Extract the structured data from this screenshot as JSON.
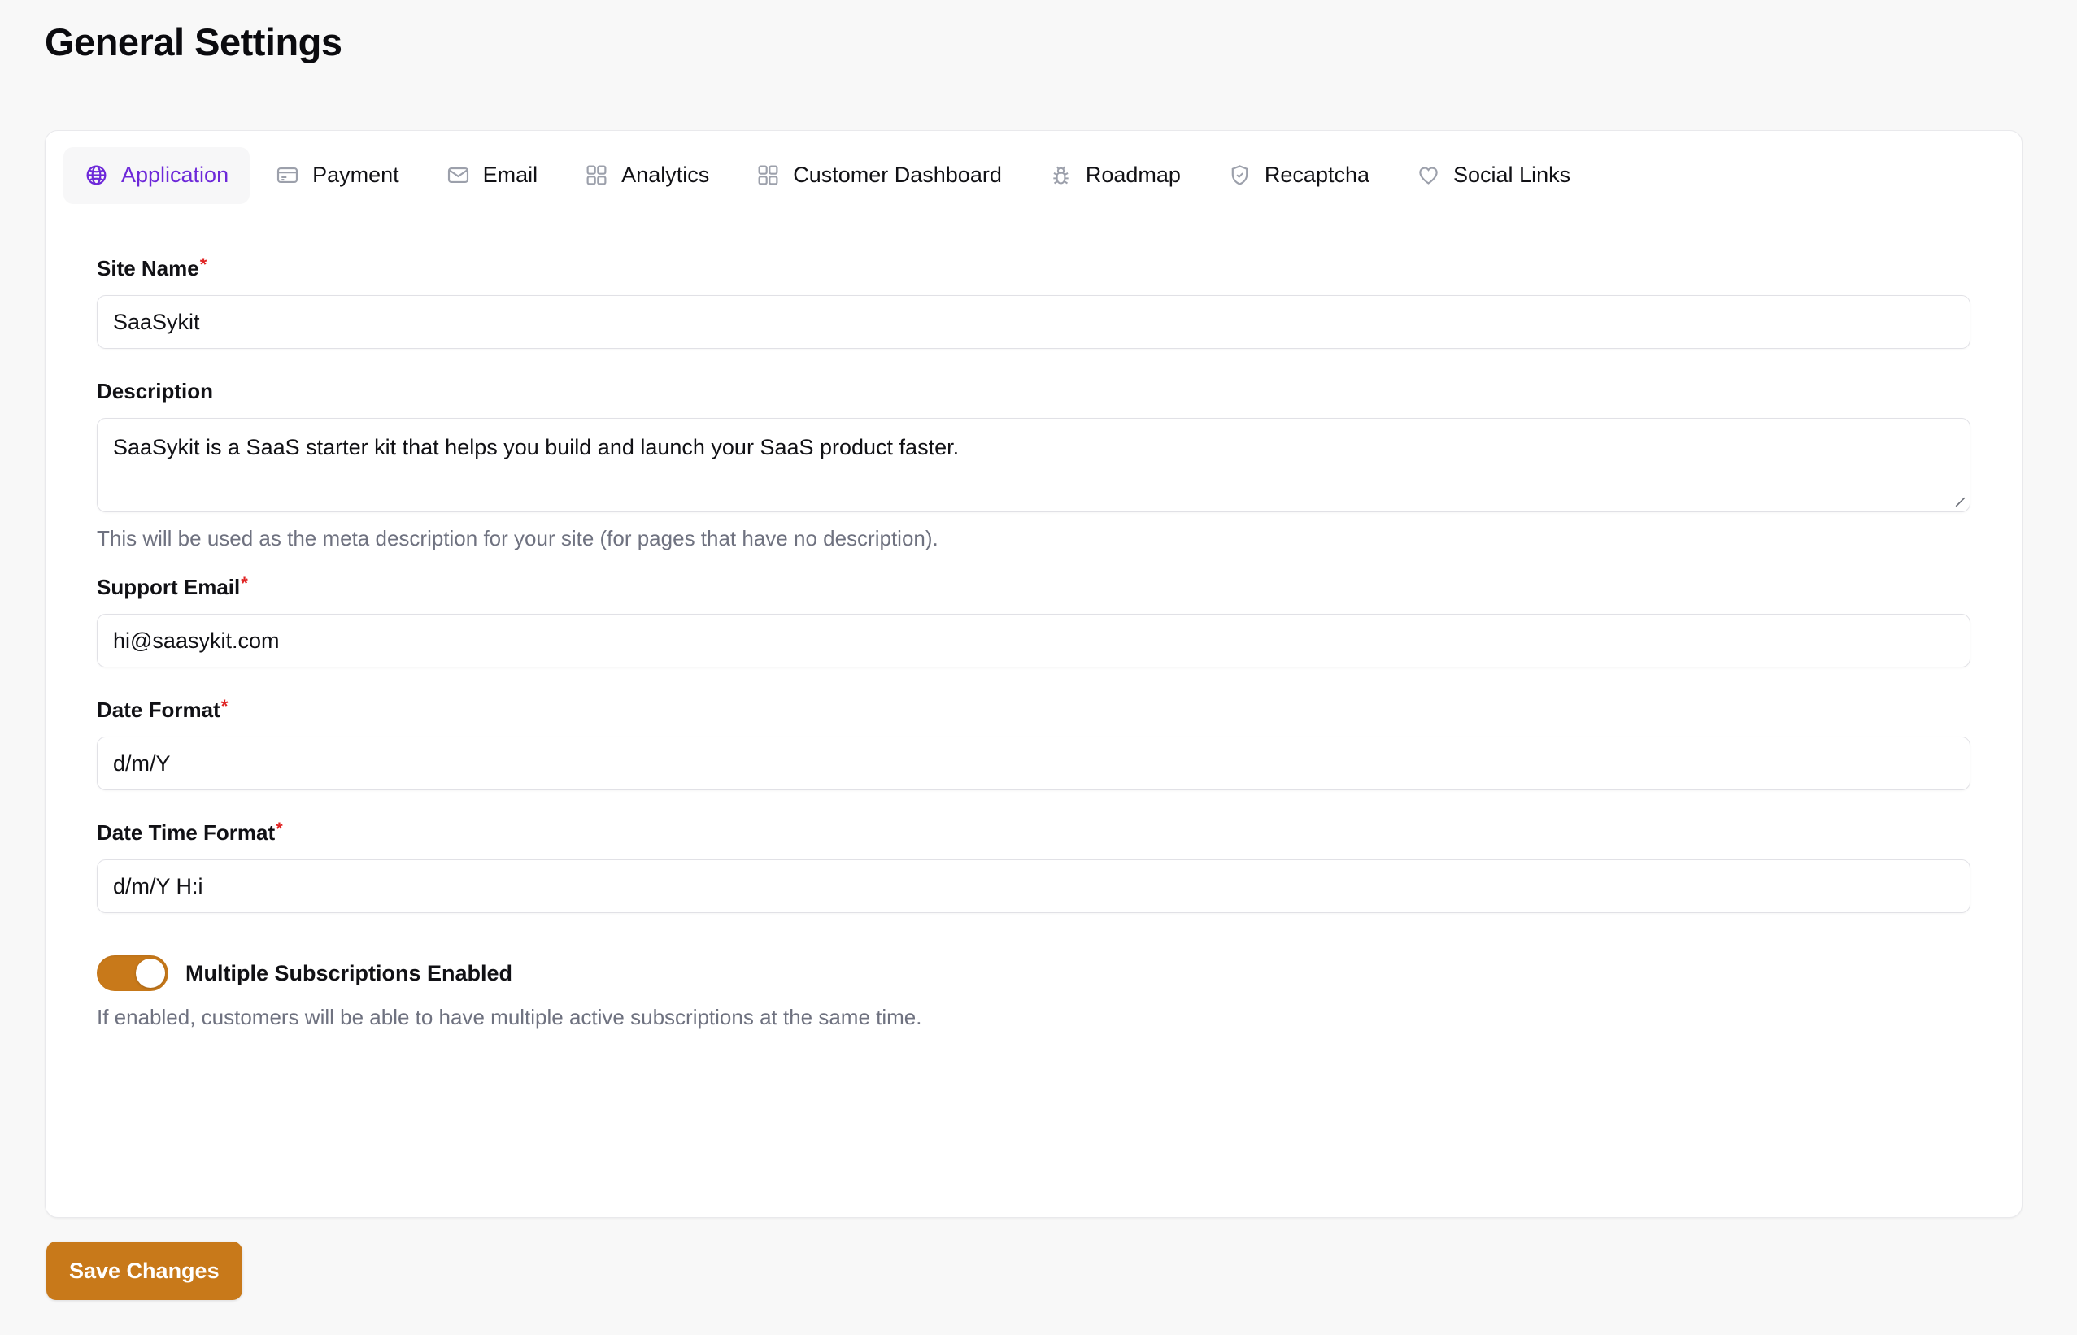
{
  "page": {
    "title": "General Settings",
    "accent_purple": "#6d28d9",
    "accent_amber": "#c8791a",
    "required_marker": "*"
  },
  "tabs": [
    {
      "label": "Application",
      "icon": "globe-icon",
      "active": true
    },
    {
      "label": "Payment",
      "icon": "credit-card-icon",
      "active": false
    },
    {
      "label": "Email",
      "icon": "envelope-icon",
      "active": false
    },
    {
      "label": "Analytics",
      "icon": "grid-squares-icon",
      "active": false
    },
    {
      "label": "Customer Dashboard",
      "icon": "grid-squares-icon",
      "active": false
    },
    {
      "label": "Roadmap",
      "icon": "bug-icon",
      "active": false
    },
    {
      "label": "Recaptcha",
      "icon": "shield-check-icon",
      "active": false
    },
    {
      "label": "Social Links",
      "icon": "heart-icon",
      "active": false
    }
  ],
  "form": {
    "site_name": {
      "label": "Site Name",
      "required": true,
      "value": "SaaSykit",
      "placeholder": ""
    },
    "description": {
      "label": "Description",
      "required": false,
      "value": "SaaSykit is a SaaS starter kit that helps you build and launch your SaaS product faster.",
      "placeholder": "",
      "help": "This will be used as the meta description for your site (for pages that have no description)."
    },
    "support_email": {
      "label": "Support Email",
      "required": true,
      "value": "hi@saasykit.com",
      "placeholder": ""
    },
    "date_format": {
      "label": "Date Format",
      "required": true,
      "value": "d/m/Y",
      "placeholder": ""
    },
    "date_time_format": {
      "label": "Date Time Format",
      "required": true,
      "value": "d/m/Y H:i",
      "placeholder": ""
    },
    "multiple_subscriptions": {
      "label": "Multiple Subscriptions Enabled",
      "enabled": true,
      "help": "If enabled, customers will be able to have multiple active subscriptions at the same time."
    }
  },
  "actions": {
    "save_label": "Save Changes"
  }
}
